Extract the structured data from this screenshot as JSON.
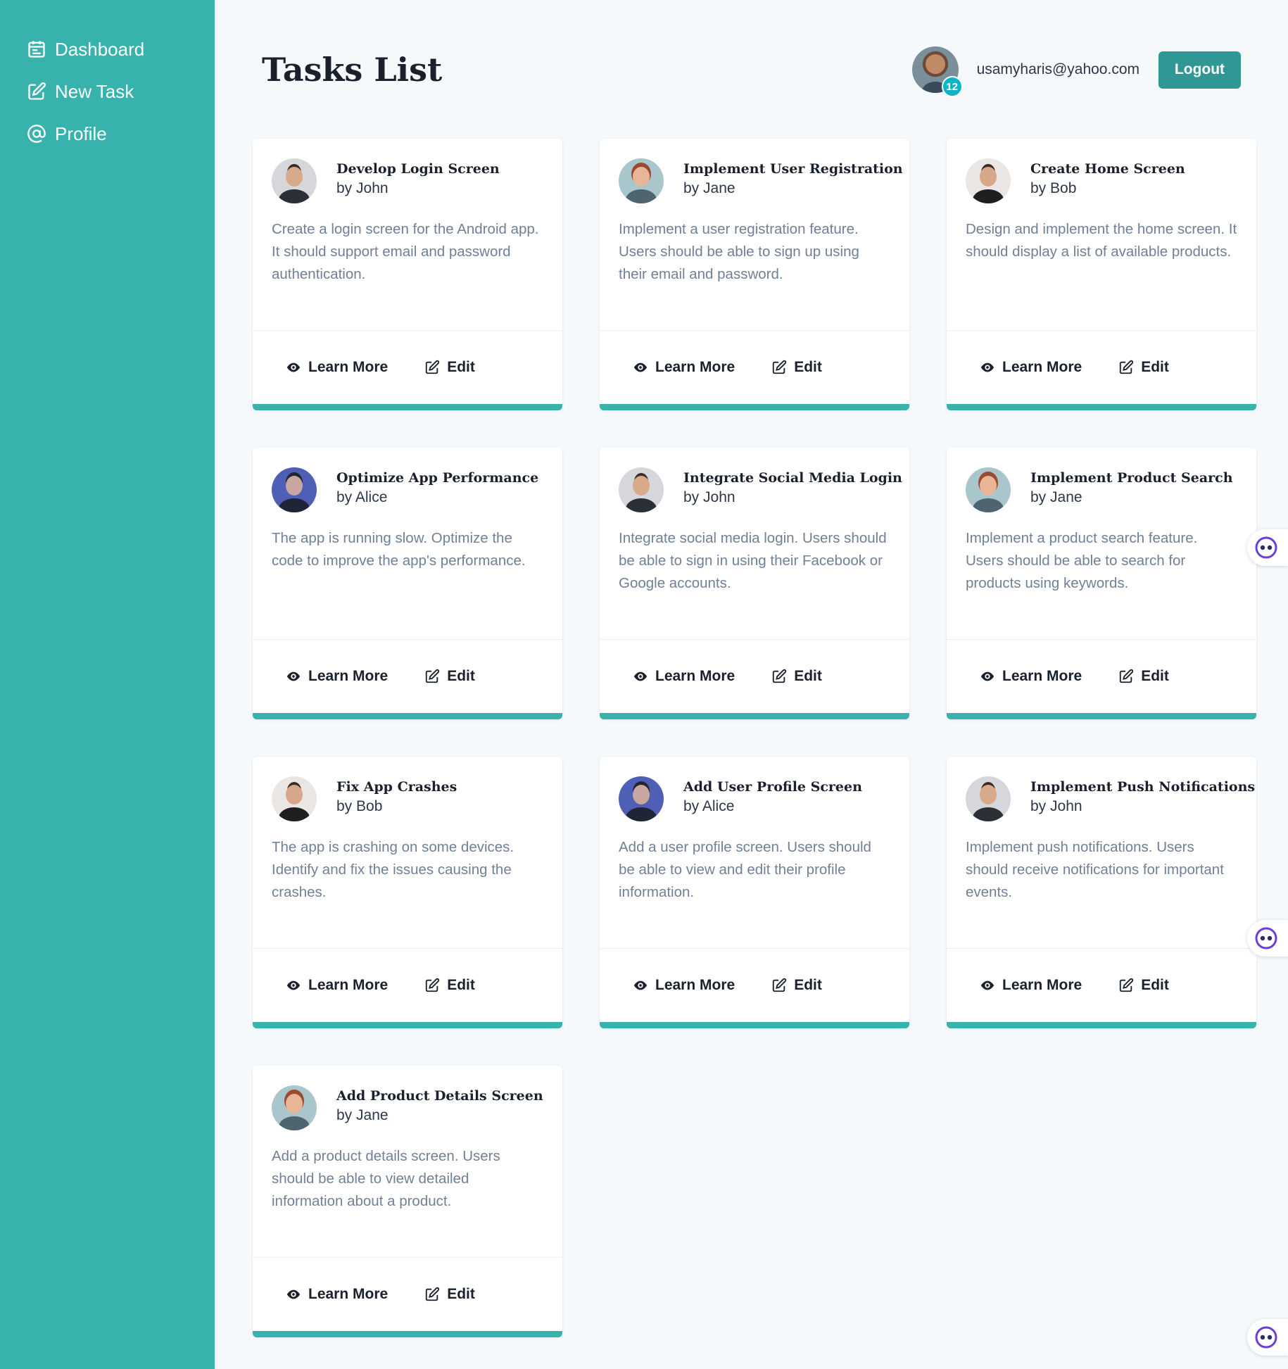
{
  "sidebar": {
    "items": [
      {
        "label": "Dashboard",
        "icon": "calendar-icon"
      },
      {
        "label": "New Task",
        "icon": "edit-icon"
      },
      {
        "label": "Profile",
        "icon": "at-icon"
      }
    ]
  },
  "header": {
    "title": "Tasks List",
    "notification_count": "12",
    "user_email": "usamyharis@yahoo.com",
    "logout_label": "Logout"
  },
  "card_actions": {
    "learn_more": "Learn More",
    "edit": "Edit"
  },
  "tasks": [
    {
      "title": "Develop Login Screen",
      "author": "by John",
      "avatar": "john",
      "description": "Create a login screen for the Android app. It should support email and password authentication."
    },
    {
      "title": "Implement User Registration",
      "author": "by Jane",
      "avatar": "jane",
      "description": "Implement a user registration feature. Users should be able to sign up using their email and password."
    },
    {
      "title": "Create Home Screen",
      "author": "by Bob",
      "avatar": "bob",
      "description": "Design and implement the home screen. It should display a list of available products."
    },
    {
      "title": "Optimize App Performance",
      "author": "by Alice",
      "avatar": "alice",
      "description": "The app is running slow. Optimize the code to improve the app's performance."
    },
    {
      "title": "Integrate Social Media Login",
      "author": "by John",
      "avatar": "john",
      "description": "Integrate social media login. Users should be able to sign in using their Facebook or Google accounts."
    },
    {
      "title": "Implement Product Search",
      "author": "by Jane",
      "avatar": "jane",
      "description": "Implement a product search feature. Users should be able to search for products using keywords."
    },
    {
      "title": "Fix App Crashes",
      "author": "by Bob",
      "avatar": "bob",
      "description": "The app is crashing on some devices. Identify and fix the issues causing the crashes."
    },
    {
      "title": "Add User Profile Screen",
      "author": "by Alice",
      "avatar": "alice",
      "description": "Add a user profile screen. Users should be able to view and edit their profile information."
    },
    {
      "title": "Implement Push Notifications",
      "author": "by John",
      "avatar": "john",
      "description": "Implement push notifications. Users should receive notifications for important events."
    },
    {
      "title": "Add Product Details Screen",
      "author": "by Jane",
      "avatar": "jane",
      "description": "Add a product details screen. Users should be able to view detailed information about a product."
    }
  ],
  "colors": {
    "sidebar": "#38b2ac",
    "accent": "#319795",
    "badge": "#0fb3c6",
    "background": "#f6f9fc"
  }
}
